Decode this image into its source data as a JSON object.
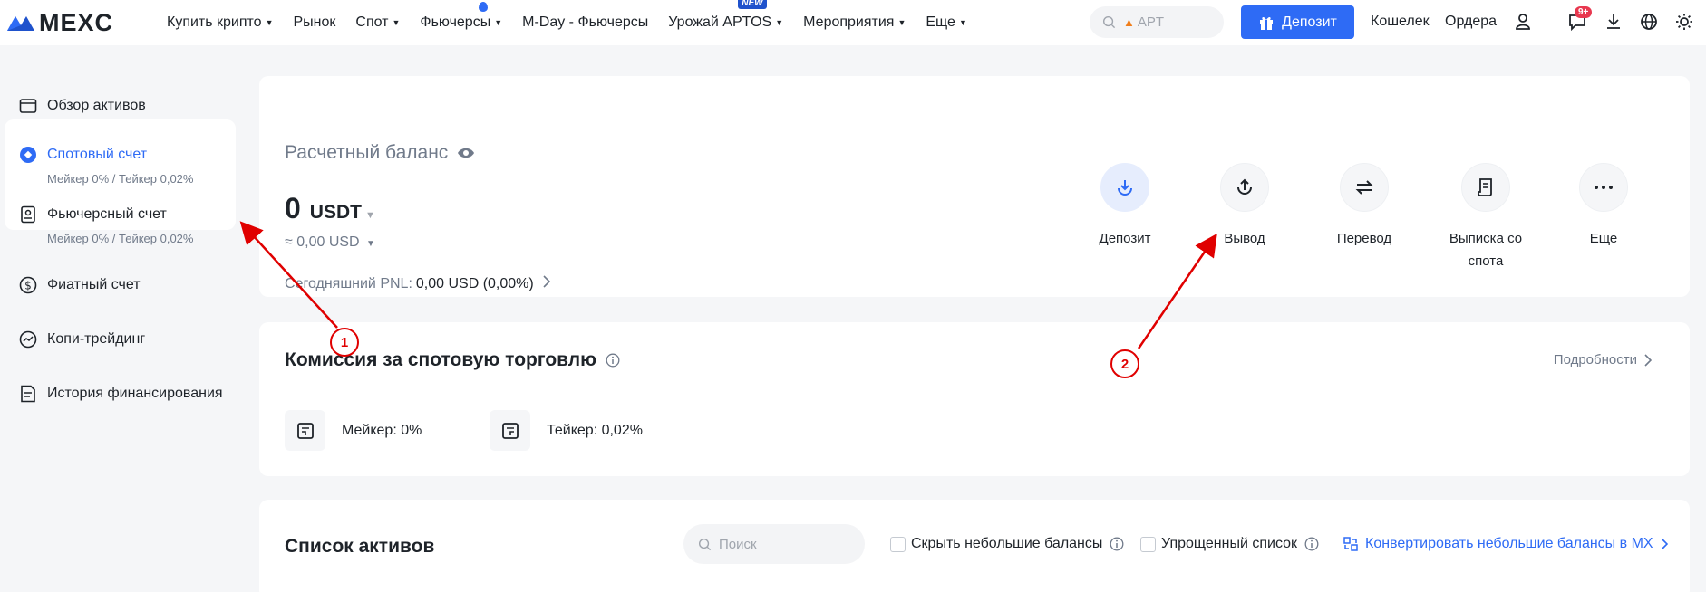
{
  "header": {
    "logo_text": "MEXC",
    "nav": [
      {
        "label": "Купить крипто",
        "caret": true
      },
      {
        "label": "Рынок",
        "caret": false
      },
      {
        "label": "Спот",
        "caret": true
      },
      {
        "label": "Фьючерсы",
        "caret": true
      },
      {
        "label": "M-Day - Фьючерсы",
        "caret": false
      },
      {
        "label": "Урожай APTOS",
        "caret": true,
        "badge": "NEW"
      },
      {
        "label": "Мероприятия",
        "caret": true
      },
      {
        "label": "Еще",
        "caret": true
      }
    ],
    "search_placeholder": "APT",
    "deposit_label": "Депозит",
    "wallet_label": "Кошелек",
    "orders_label": "Ордера",
    "notif_count": "9+",
    "brand_color": "#2e6bf5"
  },
  "sidebar": {
    "items": [
      {
        "title": "Обзор активов",
        "subtitle": ""
      },
      {
        "title": "Спотовый счет",
        "subtitle": "Мейкер 0% / Тейкер 0,02%"
      },
      {
        "title": "Фьючерсный счет",
        "subtitle": "Мейкер 0% / Тейкер 0,02%"
      },
      {
        "title": "Фиатный счет",
        "subtitle": ""
      },
      {
        "title": "Копи-трейдинг",
        "subtitle": ""
      },
      {
        "title": "История финансирования",
        "subtitle": ""
      }
    ]
  },
  "balance": {
    "label": "Расчетный баланс",
    "value": "0",
    "currency": "USDT",
    "usd": "≈ 0,00 USD",
    "pnl_label": "Сегодняшний PNL:",
    "pnl_value": "0,00 USD (0,00%)"
  },
  "actions": [
    {
      "label": "Депозит",
      "icon": "deposit-icon"
    },
    {
      "label": "Вывод",
      "icon": "withdraw-icon"
    },
    {
      "label": "Перевод",
      "icon": "transfer-icon"
    },
    {
      "label": "Выписка со спота",
      "icon": "statement-icon"
    },
    {
      "label": "Еще",
      "icon": "more-icon"
    }
  ],
  "fees": {
    "title": "Комиссия за спотовую торговлю",
    "details_label": "Подробности",
    "maker": "Мейкер: 0%",
    "taker": "Тейкер: 0,02%"
  },
  "assets": {
    "title": "Список активов",
    "search_placeholder": "Поиск",
    "hide_small": "Скрыть небольшие балансы",
    "simplified": "Упрощенный список",
    "convert": "Конвертировать небольшие балансы в MX"
  },
  "annotations": [
    {
      "label": "1"
    },
    {
      "label": "2"
    }
  ]
}
